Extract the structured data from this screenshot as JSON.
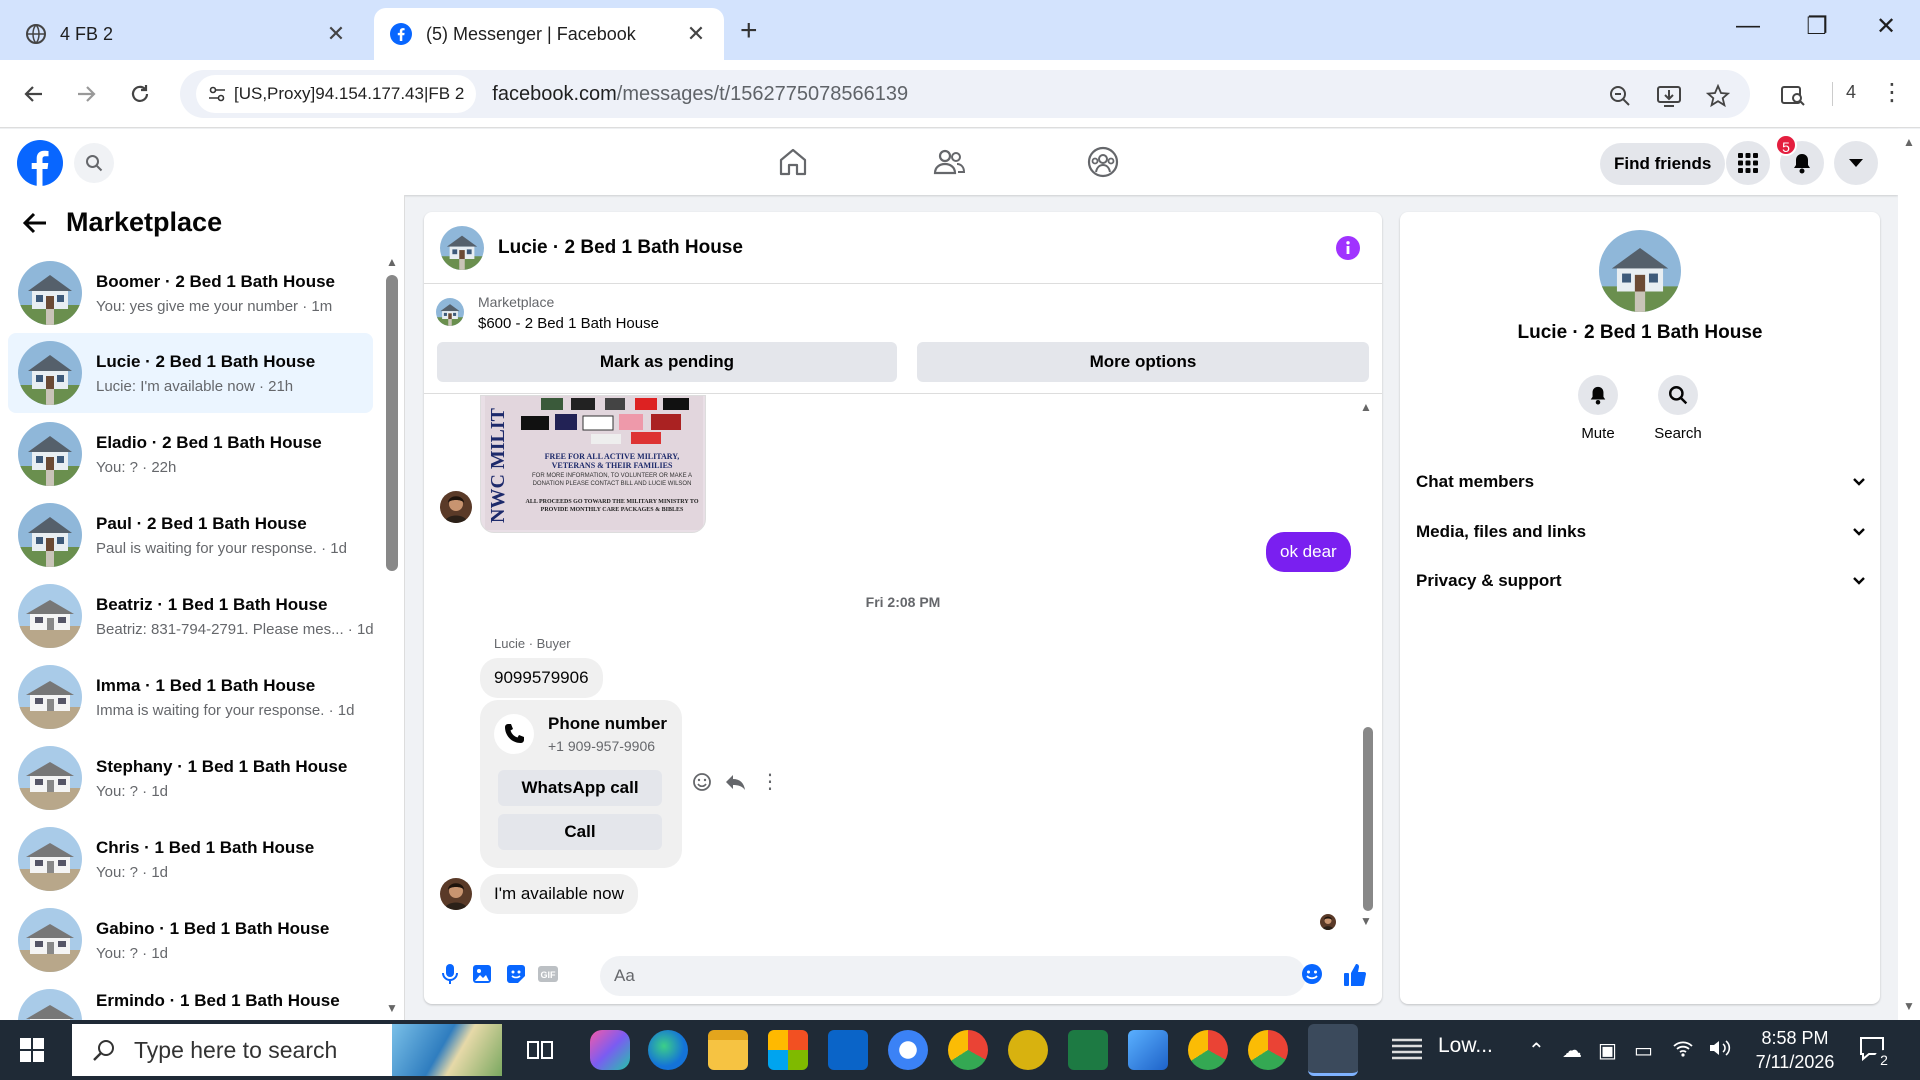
{
  "browser": {
    "tabs": [
      {
        "title": "4 FB 2"
      },
      {
        "title": "(5) Messenger | Facebook"
      }
    ],
    "new_tab": "+",
    "proxy_chip": "[US,Proxy]94.154.177.43|FB 2",
    "url_host": "facebook.com",
    "url_path": "/messages/t/1562775078566139",
    "profile_count": "4"
  },
  "fb": {
    "find_friends": "Find friends",
    "notification_count": "5"
  },
  "left": {
    "title": "Marketplace",
    "conversations": [
      {
        "name": "Boomer · 2 Bed 1 Bath House",
        "snippet": "You: yes give me your number · 1m"
      },
      {
        "name": "Lucie · 2 Bed 1 Bath House",
        "snippet": "Lucie: I'm available now · 21h"
      },
      {
        "name": "Eladio · 2 Bed 1 Bath House",
        "snippet": "You: ? · 22h"
      },
      {
        "name": "Paul · 2 Bed 1 Bath House",
        "snippet": "Paul is waiting for your response. · 1d"
      },
      {
        "name": "Beatriz · 1 Bed 1 Bath House",
        "snippet": "Beatriz: 831-794-2791. Please mes... · 1d"
      },
      {
        "name": "Imma · 1 Bed 1 Bath House",
        "snippet": "Imma is waiting for your response. · 1d"
      },
      {
        "name": "Stephany · 1 Bed 1 Bath House",
        "snippet": "You: ? · 1d"
      },
      {
        "name": "Chris · 1 Bed 1 Bath House",
        "snippet": "You: ? · 1d"
      },
      {
        "name": "Gabino · 1 Bed 1 Bath House",
        "snippet": "You: ? · 1d"
      },
      {
        "name": "Ermindo · 1 Bed 1 Bath House",
        "snippet": ""
      }
    ]
  },
  "chat": {
    "title": "Lucie · 2 Bed 1 Bath House",
    "marketplace_label": "Marketplace",
    "product": "$600 - 2 Bed 1 Bath House",
    "mark_pending": "Mark as pending",
    "more_options": "More options",
    "flyer_heading": "NWC MILIT",
    "flyer_line1": "FREE FOR ALL ACTIVE MILITARY, VETERANS & THEIR FAMILIES",
    "flyer_line2": "FOR MORE INFORMATION, TO VOLUNTEER OR MAKE A DONATION PLEASE CONTACT BILL AND LUCIE WILSON",
    "flyer_line3": "ALL PROCEEDS GO TOWARD THE MILITARY MINISTRY TO PROVIDE MONTHLY CARE PACKAGES & BIBLES",
    "outgoing_msg": "ok dear",
    "timestamp": "Fri 2:08 PM",
    "sender_label": "Lucie · Buyer",
    "phone_msg": "9099579906",
    "phone_card_title": "Phone number",
    "phone_card_number": "+1 909-957-9906",
    "whatsapp_call": "WhatsApp call",
    "call": "Call",
    "last_msg": "I'm available now",
    "input_placeholder": "Aa"
  },
  "right": {
    "name": "Lucie · 2 Bed 1 Bath House",
    "mute": "Mute",
    "search": "Search",
    "rows": [
      "Chat members",
      "Media, files and links",
      "Privacy & support"
    ]
  },
  "taskbar": {
    "search_placeholder": "Type here to search",
    "weather": "Low...",
    "time": "8:58 PM",
    "date": "7/11/2026",
    "notif_count": "2"
  },
  "colors": {
    "fb_blue": "#0866ff",
    "messenger_purple": "#7a1ff0",
    "active_conv": "#ebf5ff"
  }
}
